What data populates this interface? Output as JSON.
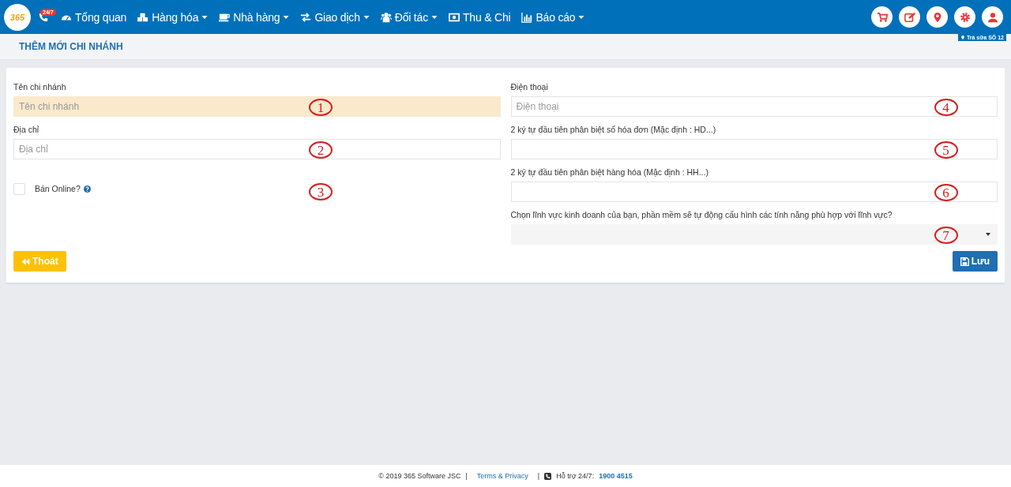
{
  "navbar": {
    "logo_text": "365",
    "hotline_badge": "24/7",
    "items": [
      {
        "label": "Tổng quan",
        "has_dropdown": false
      },
      {
        "label": "Hàng hóa",
        "has_dropdown": true
      },
      {
        "label": "Nhà hàng",
        "has_dropdown": true
      },
      {
        "label": "Giao dịch",
        "has_dropdown": true
      },
      {
        "label": "Đối tác",
        "has_dropdown": true
      },
      {
        "label": "Thu & Chi",
        "has_dropdown": false
      },
      {
        "label": "Báo cáo",
        "has_dropdown": true
      }
    ],
    "branch": "Trà sữa SÔ 12"
  },
  "page_title": "THÊM MỚI CHI NHÁNH",
  "form": {
    "left_fields": [
      {
        "kind": "text",
        "label": "Tên chi nhánh",
        "placeholder": "Tên chi nhánh",
        "highlighted": true,
        "marker": "1"
      },
      {
        "kind": "text",
        "label": "Địa chỉ",
        "placeholder": "Địa chỉ",
        "highlighted": false,
        "marker": "2"
      },
      {
        "kind": "checkbox",
        "label": "Bán Online?",
        "checked": false,
        "marker": "3"
      }
    ],
    "right_fields": [
      {
        "kind": "text",
        "label": "Điện thoại",
        "placeholder": "Điện thoại",
        "highlighted": false,
        "marker": "4"
      },
      {
        "kind": "text",
        "label": "2 ký tự đầu tiên phân biệt số hóa đơn (Mặc định : HD...)",
        "highlighted": false,
        "marker": "5"
      },
      {
        "kind": "text",
        "label": "2 ký tự đầu tiên phân biệt hàng hóa (Mặc định : HH...)",
        "highlighted": false,
        "marker": "6"
      },
      {
        "kind": "select",
        "label": "Chọn lĩnh vực kinh doanh của bạn, phần mềm sẽ tự động cấu hình các tính năng phù hợp với lĩnh vực?",
        "marker": "7"
      }
    ],
    "exit_button": "Thoát",
    "save_button": "Lưu"
  },
  "footer": {
    "copyright": "© 2019 365 Software JSC",
    "separator_1": "|",
    "terms_link": "Terms & Privacy",
    "separator_2": "|",
    "support_label": "Hỗ trợ 24/7:",
    "support_phone": "1900 4515"
  }
}
